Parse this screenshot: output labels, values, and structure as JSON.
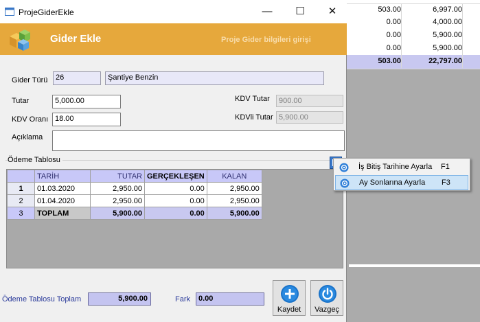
{
  "background_grid": {
    "rows": [
      {
        "col1": "503.00",
        "col2": "6,997.00"
      },
      {
        "col1": "0.00",
        "col2": "4,000.00"
      },
      {
        "col1": "0.00",
        "col2": "5,900.00"
      },
      {
        "col1": "0.00",
        "col2": "5,900.00"
      }
    ],
    "total": {
      "col1": "503.00",
      "col2": "22,797.00"
    }
  },
  "window": {
    "title": "ProjeGiderEkle",
    "minimize": "—",
    "maximize": "☐",
    "close": "✕"
  },
  "banner": {
    "title": "Gider Ekle",
    "subtitle": "Proje Gider bilgileri girişi"
  },
  "form": {
    "gider_turu_label": "Gider Türü",
    "gider_turu_code": "26",
    "gider_turu_name": "Şantiye Benzin",
    "tutar_label": "Tutar",
    "tutar_value": "5,000.00",
    "kdv_orani_label": "KDV Oranı",
    "kdv_orani_value": "18.00",
    "kdv_tutar_label": "KDV Tutar",
    "kdv_tutar_value": "900.00",
    "kdvli_tutar_label": "KDVli Tutar",
    "kdvli_tutar_value": "5,900.00",
    "aciklama_label": "Açıklama",
    "aciklama_value": ""
  },
  "payment_table": {
    "section_label": "Ödeme Tablosu",
    "headers": {
      "tarih": "TARİH",
      "tutar": "TUTAR",
      "gerceklesen": "GERÇEKLEŞEN",
      "kalan": "KALAN"
    },
    "rows": [
      {
        "no": "1",
        "tarih": "01.03.2020",
        "tutar": "2,950.00",
        "gerceklesen": "0.00",
        "kalan": "2,950.00"
      },
      {
        "no": "2",
        "tarih": "01.04.2020",
        "tutar": "2,950.00",
        "gerceklesen": "0.00",
        "kalan": "2,950.00"
      }
    ],
    "total": {
      "no": "3",
      "tarih": "TOPLAM",
      "tutar": "5,900.00",
      "gerceklesen": "0.00",
      "kalan": "5,900.00"
    }
  },
  "context_menu": {
    "items": [
      {
        "label": "İş Bitiş Tarihine Ayarla",
        "shortcut": "F1",
        "icon": "gear-icon"
      },
      {
        "label": "Ay Sonlarına Ayarla",
        "shortcut": "F3",
        "icon": "gear-icon"
      }
    ]
  },
  "footer": {
    "odeme_toplam_label": "Ödeme Tablosu Toplam",
    "odeme_toplam_value": "5,900.00",
    "fark_label": "Fark",
    "fark_value": "0.00",
    "save_label": "Kaydet",
    "cancel_label": "Vazgeç"
  },
  "colors": {
    "banner": "#e6a83c",
    "grid_header": "#c8c8f8",
    "total_row": "#c8c8f0",
    "menu_highlight": "#cde4f7",
    "save_icon": "#1a73c9",
    "cancel_icon": "#1a73c9"
  }
}
